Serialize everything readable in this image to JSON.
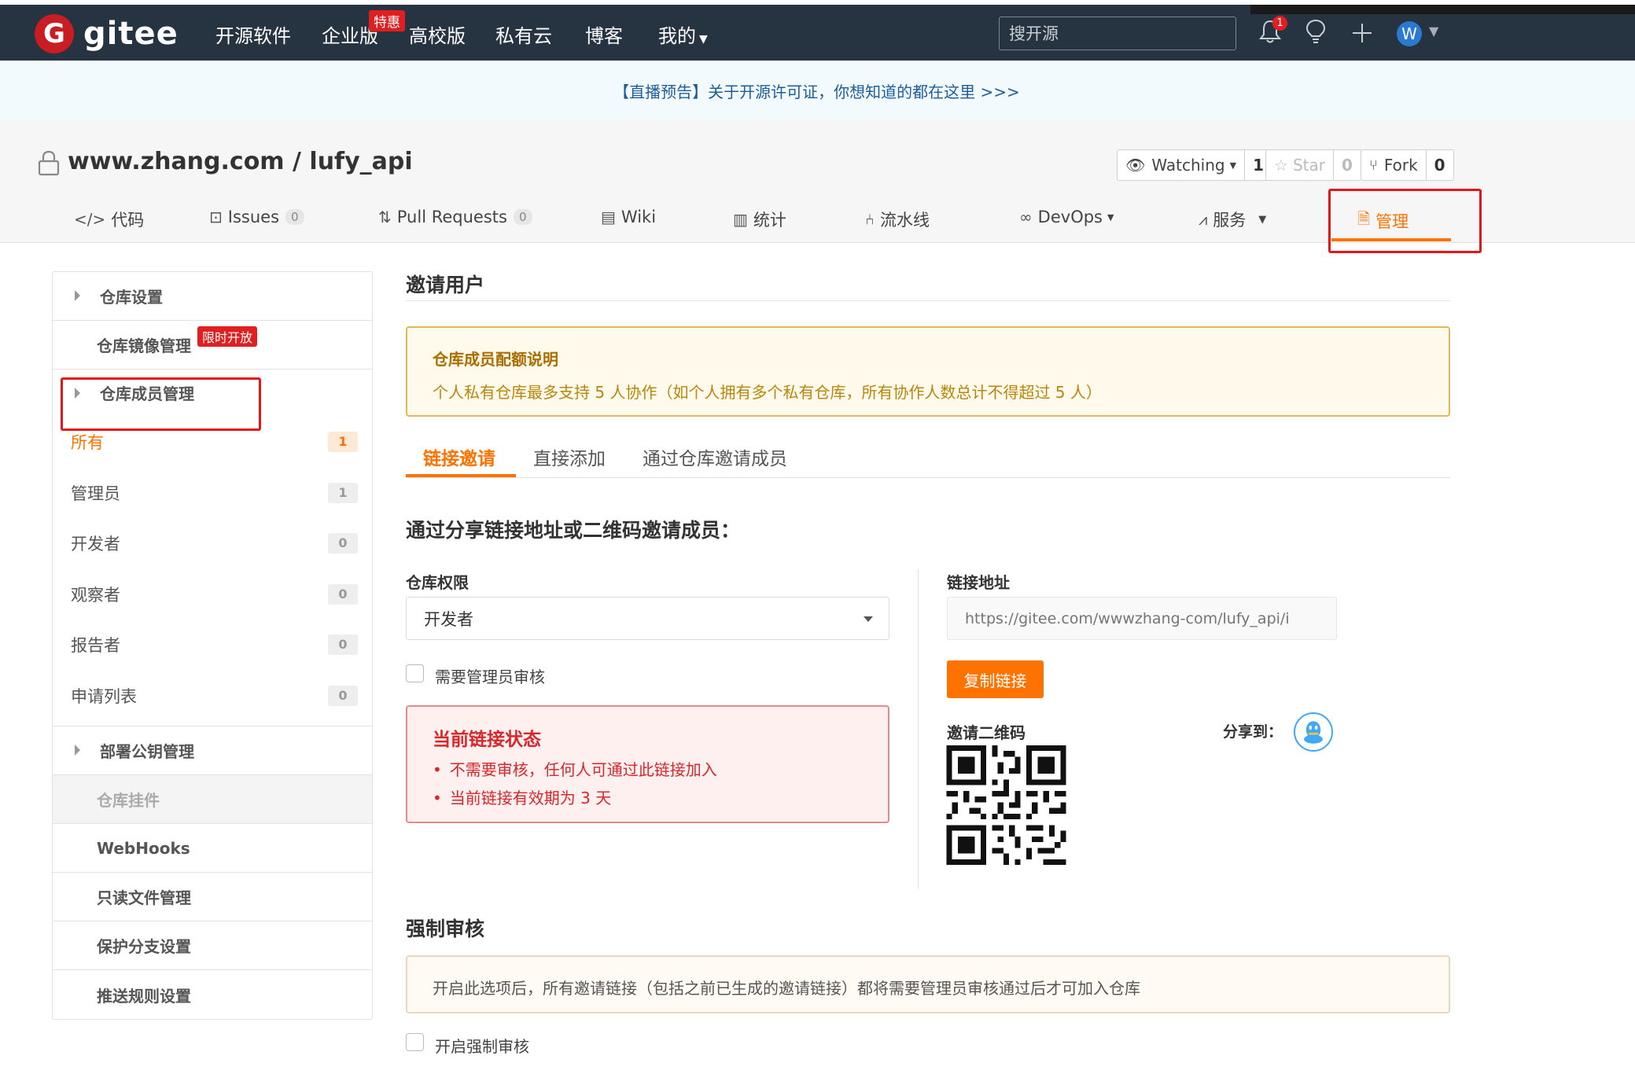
{
  "topnav": {
    "logo_letter": "G",
    "logo_text": "gitee",
    "items": [
      "开源软件",
      "企业版",
      "高校版",
      "私有云",
      "博客",
      "我的"
    ],
    "enterprise_tag": "特惠",
    "search_placeholder": "搜开源",
    "notification_count": "1",
    "avatar_letter": "W"
  },
  "announcement": "【直播预告】关于开源许可证，你想知道的都在这里 >>>",
  "repo": {
    "title": "www.zhang.com / lufy_api",
    "watching_label": "Watching",
    "watching_count": "1",
    "star_label": "Star",
    "star_count": "0",
    "fork_label": "Fork",
    "fork_count": "0",
    "tabs": [
      {
        "label": "代码",
        "icon": "code-icon"
      },
      {
        "label": "Issues",
        "badge": "0",
        "icon": "issue-icon"
      },
      {
        "label": "Pull Requests",
        "badge": "0",
        "icon": "pull-request-icon"
      },
      {
        "label": "Wiki",
        "icon": "book-icon"
      },
      {
        "label": "统计",
        "icon": "bar-chart-icon"
      },
      {
        "label": "流水线",
        "icon": "pipeline-icon"
      },
      {
        "label": "DevOps",
        "icon": "infinity-icon"
      },
      {
        "label": "服务",
        "icon": "pulse-icon"
      },
      {
        "label": "管理",
        "icon": "manage-icon"
      }
    ]
  },
  "sidebar": {
    "repo_settings": "仓库设置",
    "mirror_mgmt": "仓库镜像管理",
    "mirror_tag": "限时开放",
    "member_mgmt": "仓库成员管理",
    "members": [
      {
        "label": "所有",
        "count": "1"
      },
      {
        "label": "管理员",
        "count": "1"
      },
      {
        "label": "开发者",
        "count": "0"
      },
      {
        "label": "观察者",
        "count": "0"
      },
      {
        "label": "报告者",
        "count": "0"
      },
      {
        "label": "申请列表",
        "count": "0"
      }
    ],
    "deploy_keys": "部署公钥管理",
    "plugins": "仓库挂件",
    "webhooks": "WebHooks",
    "readonly_files": "只读文件管理",
    "branch_protection": "保护分支设置",
    "push_rules": "推送规则设置"
  },
  "main": {
    "title": "邀请用户",
    "quota_title": "仓库成员配额说明",
    "quota_desc": "个人私有仓库最多支持 5 人协作（如个人拥有多个私有仓库，所有协作人数总计不得超过 5 人）",
    "tabs": [
      "链接邀请",
      "直接添加",
      "通过仓库邀请成员"
    ],
    "invite_heading": "通过分享链接地址或二维码邀请成员：",
    "permission_label": "仓库权限",
    "permission_value": "开发者",
    "require_review_label": "需要管理员审核",
    "status_title": "当前链接状态",
    "status_items": [
      "不需要审核，任何人可通过此链接加入",
      "当前链接有效期为 3 天"
    ],
    "link_label": "链接地址",
    "link_placeholder": "https://gitee.com/wwwzhang-com/lufy_api/i",
    "copy_button": "复制链接",
    "qr_label": "邀请二维码",
    "share_label": "分享到：",
    "force_title": "强制审核",
    "force_desc": "开启此选项后，所有邀请链接（包括之前已生成的邀请链接）都将需要管理员审核通过后才可加入仓库",
    "force_checkbox_label": "开启强制审核"
  },
  "colors": {
    "nav_bg": "#263341",
    "accent": "#fe7300",
    "brand_red": "#c71d23",
    "highlight_red": "#e5151c"
  }
}
